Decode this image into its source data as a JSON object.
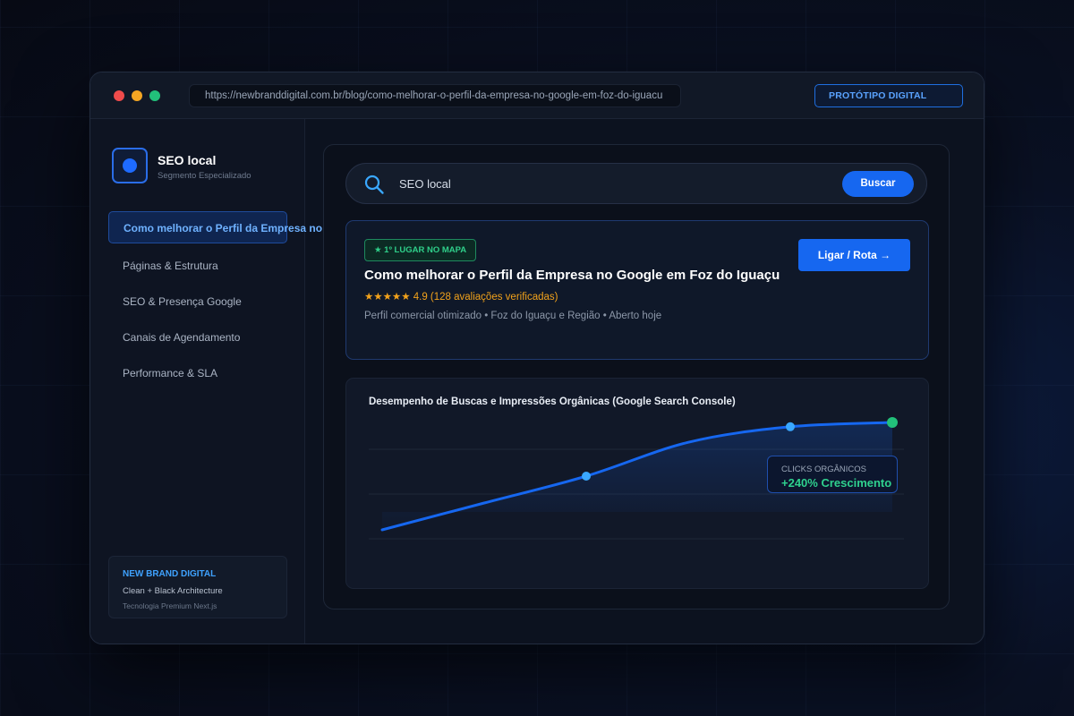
{
  "browser": {
    "url": "https://newbranddigital.com.br/blog/como-melhorar-o-perfil-da-empresa-no-google-em-foz-do-iguacu",
    "badge": "PROTÓTIPO DIGITAL"
  },
  "sidebar": {
    "brand_title": "SEO local",
    "brand_subtitle": "Segmento Especializado",
    "items": [
      {
        "label": "Como melhorar o Perfil da Empresa no Google",
        "active": true
      },
      {
        "label": "Páginas & Estrutura",
        "active": false
      },
      {
        "label": "SEO & Presença Google",
        "active": false
      },
      {
        "label": "Canais de Agendamento",
        "active": false
      },
      {
        "label": "Performance & SLA",
        "active": false
      }
    ],
    "footer": {
      "title": "NEW BRAND DIGITAL",
      "line1": "Clean + Black Architecture",
      "line2": "Tecnologia Premium Next.js"
    }
  },
  "search": {
    "query": "SEO local",
    "button_label": "Buscar"
  },
  "result": {
    "badge": "★ 1º LUGAR NO MAPA",
    "title": "Como melhorar o Perfil da Empresa no Google em Foz do Iguaçu",
    "rating": "★★★★★ 4.9 (128 avaliações verificadas)",
    "meta": "Perfil comercial otimizado • Foz do Iguaçu e Região • Aberto hoje",
    "cta_label": "Ligar / Rota →"
  },
  "chart_data": {
    "type": "line",
    "title": "Desempenho de Buscas e Impressões Orgânicas (Google Search Console)",
    "series": [
      {
        "values": [
          0.0,
          0.25,
          0.5,
          0.815,
          0.96,
          1.0
        ]
      }
    ],
    "highlighted_points": [
      2,
      4,
      5
    ],
    "ylim": [
      0,
      1
    ],
    "grid": true,
    "callout": {
      "label": "CLICKS ORGÂNICOS",
      "value": "+240% Crescimento"
    },
    "colors": {
      "line": "#1667f0",
      "point": "#3aa8ff",
      "end_point": "#22c07a"
    }
  }
}
